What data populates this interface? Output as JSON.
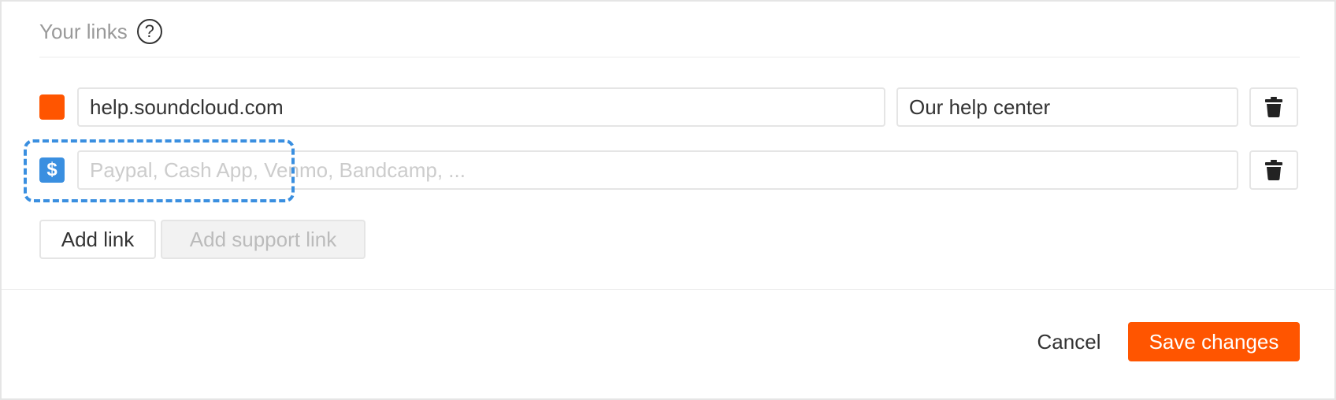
{
  "section": {
    "title": "Your links",
    "help_glyph": "?"
  },
  "links": [
    {
      "badge_icon": "orange-square-icon",
      "badge_color": "#ff5500",
      "url_value": "help.soundcloud.com",
      "title_value": "Our help center",
      "delete_icon": "trash-icon"
    },
    {
      "badge_icon": "dollar-icon",
      "badge_glyph": "$",
      "badge_color": "#3a8fe0",
      "url_placeholder": "Paypal, Cash App, Venmo, Bandcamp, ...",
      "delete_icon": "trash-icon"
    }
  ],
  "actions": {
    "add_link_label": "Add link",
    "add_support_link_label": "Add support link"
  },
  "footer": {
    "cancel_label": "Cancel",
    "save_label": "Save changes"
  },
  "colors": {
    "accent": "#ff5500",
    "highlight": "#3a8fe0"
  }
}
